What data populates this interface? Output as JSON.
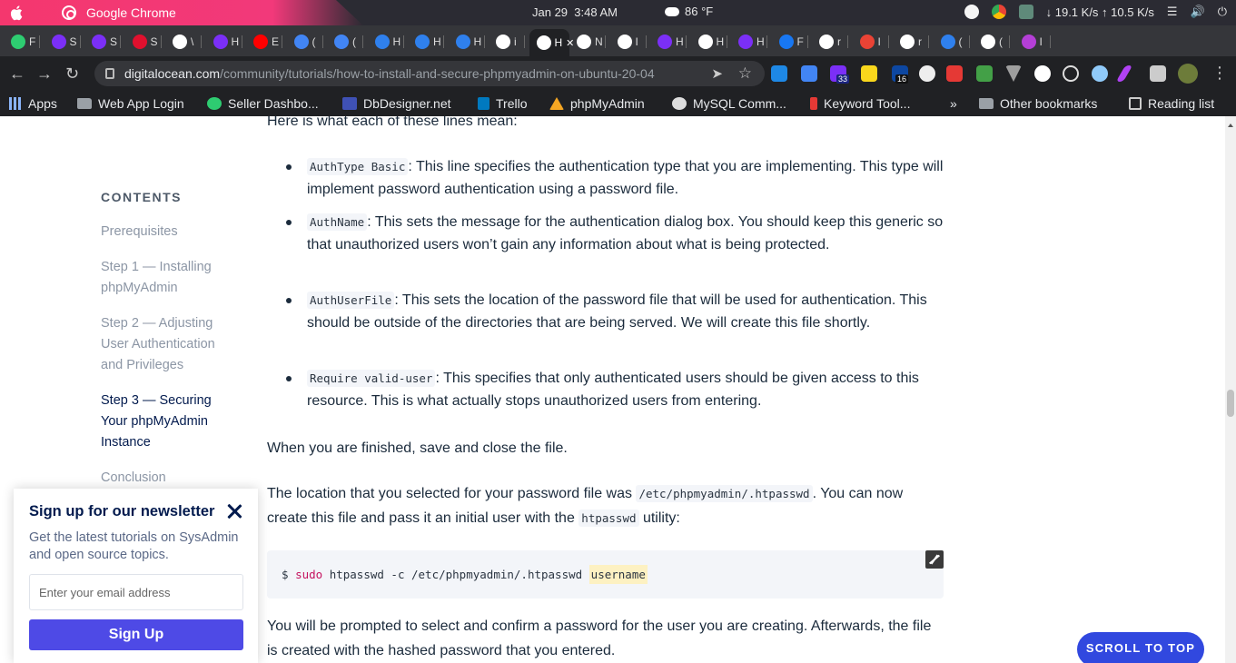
{
  "os": {
    "app_name": "Google Chrome",
    "date": "Jan 29",
    "time": "3:48 AM",
    "temperature": "86 °F",
    "network": "↓ 19.1 K/s ↑ 10.5 K/s"
  },
  "tabs": [
    {
      "short": "F",
      "color": "#2ecc71"
    },
    {
      "short": "S",
      "color": "#7b2ff7"
    },
    {
      "short": "S",
      "color": "#7b2ff7"
    },
    {
      "short": "S",
      "color": "#e0102e"
    },
    {
      "short": "\\",
      "color": "#ffffff"
    },
    {
      "short": "H",
      "color": "#7b2ff7"
    },
    {
      "short": "E",
      "color": "#ff0000"
    },
    {
      "short": "(",
      "color": "#4285f4"
    },
    {
      "short": "(",
      "color": "#4285f4"
    },
    {
      "short": "H",
      "color": "#2f80ed"
    },
    {
      "short": "H",
      "color": "#2f80ed"
    },
    {
      "short": "H",
      "color": "#2f80ed"
    },
    {
      "short": "i",
      "color": "#ffffff"
    },
    {
      "short": "H",
      "color": "#ffffff"
    },
    {
      "short": "N",
      "color": "#ffffff"
    },
    {
      "short": "I",
      "color": "#ffffff"
    },
    {
      "short": "H",
      "color": "#7b2ff7"
    },
    {
      "short": "H",
      "color": "#ffffff"
    },
    {
      "short": "H",
      "color": "#7b2ff7"
    },
    {
      "short": "F",
      "color": "#1877f2"
    },
    {
      "short": "r",
      "color": "#ffffff"
    },
    {
      "short": "I",
      "color": "#ea4335"
    },
    {
      "short": "r",
      "color": "#ffffff"
    },
    {
      "short": "(",
      "color": "#2f80ed"
    },
    {
      "short": "(",
      "color": "#ffffff"
    },
    {
      "short": "I",
      "color": "#b43fd6"
    }
  ],
  "address": {
    "host": "digitalocean.com",
    "path": "/community/tutorials/how-to-install-and-secure-phpmyadmin-on-ubuntu-20-04"
  },
  "bookmarks": [
    {
      "label": "Apps"
    },
    {
      "label": "Web App Login"
    },
    {
      "label": "Seller Dashbo..."
    },
    {
      "label": "DbDesigner.net"
    },
    {
      "label": "Trello"
    },
    {
      "label": "phpMyAdmin"
    },
    {
      "label": "MySQL Comm..."
    },
    {
      "label": "Keyword Tool..."
    },
    {
      "label": "»"
    },
    {
      "label": "Other bookmarks"
    },
    {
      "label": "Reading list"
    }
  ],
  "extension_badges": {
    "first": "33",
    "second": "16"
  },
  "toc": {
    "title": "CONTENTS",
    "items": [
      "Prerequisites",
      "Step 1 — Installing phpMyAdmin",
      "Step 2 — Adjusting User Authentication and Privileges",
      "Step 3 — Securing Your phpMyAdmin Instance",
      "Conclusion"
    ]
  },
  "article": {
    "intro": "Here is what each of these lines mean:",
    "items": [
      {
        "code": "AuthType Basic",
        "text": ": This line specifies the authentication type that you are implementing. This type will implement password authentication using a password file."
      },
      {
        "code": "AuthName",
        "text": ": This sets the message for the authentication dialog box. You should keep this generic so that unauthorized users won’t gain any information about what is being protected."
      },
      {
        "code": "AuthUserFile",
        "text": ": This sets the location of the password file that will be used for authentication. This should be outside of the directories that are being served. We will create this file shortly."
      },
      {
        "code": "Require valid-user",
        "text": ": This specifies that only authenticated users should be given access to this resource. This is what actually stops unauthorized users from entering."
      }
    ],
    "para1": "When you are finished, save and close the file.",
    "para2_a": "The location that you selected for your password file was ",
    "para2_code1": "/etc/phpmyadmin/.htpasswd",
    "para2_b": ". You can now create this file and pass it an initial user with the ",
    "para2_code2": "htpasswd",
    "para2_c": " utility:",
    "cmd_prompt": "$ ",
    "cmd_sudo": "sudo",
    "cmd_rest": " htpasswd -c /etc/phpmyadmin/.htpasswd ",
    "cmd_user": "username",
    "para3": "You will be prompted to select and confirm a password for the user you are creating. Afterwards, the file is created with the hashed password that you entered."
  },
  "newsletter": {
    "title": "Sign up for our newsletter",
    "desc": "Get the latest tutorials on SysAdmin and open source topics.",
    "placeholder": "Enter your email address",
    "button": "Sign Up"
  },
  "scroll_top": "SCROLL TO TOP"
}
